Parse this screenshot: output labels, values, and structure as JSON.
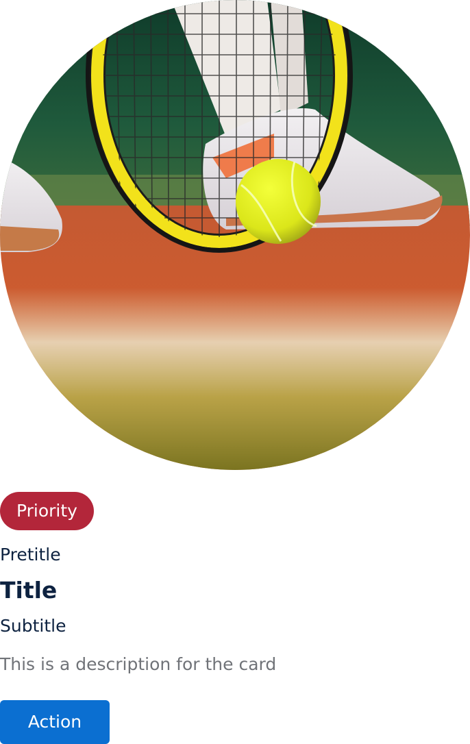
{
  "card": {
    "image_alt": "Tennis racket and ball on a clay court",
    "badge": {
      "label": "Priority",
      "color": "#b3263a"
    },
    "pretitle": "Pretitle",
    "title": "Title",
    "subtitle": "Subtitle",
    "description": "This is a description for the card",
    "action": {
      "label": "Action",
      "color": "#0b6fd1"
    }
  }
}
